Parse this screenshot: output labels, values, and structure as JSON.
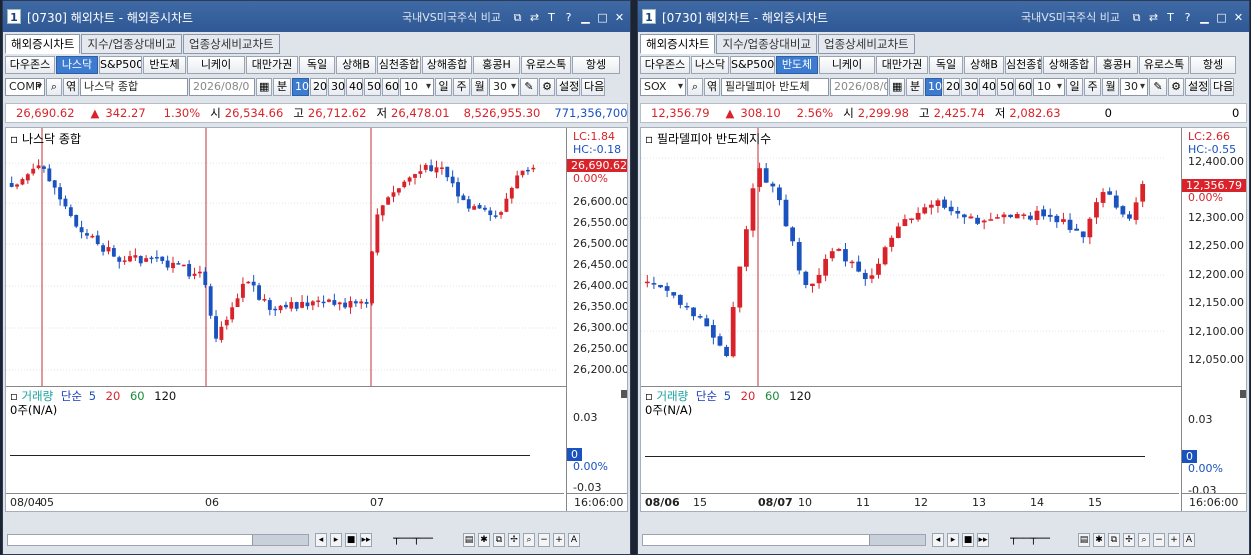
{
  "windows": [
    {
      "id": "left",
      "num": "1",
      "title": "[0730] 해외차트 - 해외증시차트",
      "compare_label": "국내VS미국주식 비교",
      "tabs": [
        "해외증시차트",
        "지수/업종상대비교",
        "업종상세비교차트"
      ],
      "active_tab": 0,
      "markets": [
        "다우존스",
        "나스닥",
        "S&P500",
        "반도체",
        "니케이",
        "대만가권",
        "독일",
        "상해B",
        "심천종합",
        "상해종합",
        "홍콩H",
        "유로스톡",
        "항셍"
      ],
      "selected_market": 1,
      "symbol": "COMP",
      "name": "나스닥 종합",
      "date": "2026/08/0",
      "period_unit": "분",
      "periods": [
        "10",
        "20",
        "30",
        "40",
        "50",
        "60"
      ],
      "period_value": "10",
      "dmy": [
        "일",
        "주",
        "월"
      ],
      "count": "30",
      "settings_label": "설정",
      "next_label": "다음",
      "quote": {
        "price": "26,690.62",
        "change": "342.27",
        "pct": "1.30%",
        "open_label": "시",
        "open": "26,534.66",
        "high_label": "고",
        "high": "26,712.62",
        "low_label": "저",
        "low": "26,478.01",
        "volume": "8,526,955.30",
        "amount": "771,356,700"
      },
      "chart_title": "나스닥 종합",
      "lc": "LC:1.84",
      "hc": "HC:-0.18",
      "price_tag": "26,690.62",
      "pct_tag": "0.00%",
      "y_ticks": [
        "26,650.00",
        "26,600.00",
        "26,550.00",
        "26,500.00",
        "26,450.00",
        "26,400.00",
        "26,350.00",
        "26,300.00",
        "26,250.00",
        "26,200.00"
      ],
      "x_ticks": [
        "08/04",
        "05",
        "06",
        "07"
      ],
      "time": "16:06:00",
      "volume": {
        "label": "거래량",
        "ma_label": "단순",
        "ma": [
          "5",
          "20",
          "60",
          "120"
        ],
        "value": "0주(N/A)",
        "ticks": [
          "0.03",
          "-0.03"
        ],
        "zero_tag": "0",
        "pct_tag": "0.00%"
      }
    },
    {
      "id": "right",
      "num": "1",
      "title": "[0730] 해외차트 - 해외증시차트",
      "compare_label": "국내VS미국주식 비교",
      "tabs": [
        "해외증시차트",
        "지수/업종상대비교",
        "업종상세비교차트"
      ],
      "active_tab": 0,
      "markets": [
        "다우존스",
        "나스닥",
        "S&P500",
        "반도체",
        "니케이",
        "대만가권",
        "독일",
        "상해B",
        "심천종합",
        "상해종합",
        "홍콩H",
        "유로스톡",
        "항셍"
      ],
      "selected_market": 3,
      "symbol": "SOX",
      "name": "필라델피아 반도체",
      "date": "2026/08/0",
      "period_unit": "분",
      "periods": [
        "10",
        "20",
        "30",
        "40",
        "50",
        "60"
      ],
      "period_value": "10",
      "dmy": [
        "일",
        "주",
        "월"
      ],
      "count": "30",
      "settings_label": "설정",
      "next_label": "다음",
      "quote": {
        "price": "12,356.79",
        "change": "308.10",
        "pct": "2.56%",
        "open_label": "시",
        "open": "2,299.98",
        "high_label": "고",
        "high": "2,425.74",
        "low_label": "저",
        "low": "2,082.63",
        "volume": "0",
        "amount": "0"
      },
      "chart_title": "필라델피아 반도체지수",
      "lc": "LC:2.66",
      "hc": "HC:-0.55",
      "price_tag": "12,356.79",
      "pct_tag": "0.00%",
      "y_ticks": [
        "12,400.00",
        "12,350.00",
        "12,300.00",
        "12,250.00",
        "12,200.00",
        "12,150.00",
        "12,100.00",
        "12,050.00"
      ],
      "x_ticks": [
        "08/06",
        "15",
        "08/07",
        "10",
        "11",
        "12",
        "13",
        "14",
        "15"
      ],
      "time": "16:06:00",
      "volume": {
        "label": "거래량",
        "ma_label": "단순",
        "ma": [
          "5",
          "20",
          "60",
          "120"
        ],
        "value": "0주(N/A)",
        "ticks": [
          "0.03",
          "-0.03"
        ],
        "zero_tag": "0",
        "pct_tag": "0.00%"
      }
    }
  ],
  "colors": {
    "up": "#d8232a",
    "down": "#1a52c0",
    "title_bar": "#2f5894",
    "selected": "#3d7bd0"
  }
}
